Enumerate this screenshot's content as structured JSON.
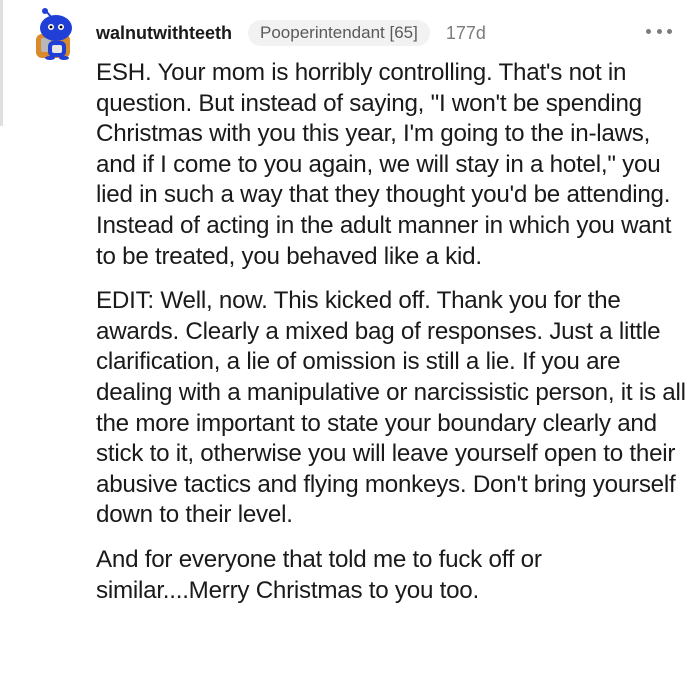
{
  "comment": {
    "username": "walnutwithteeth",
    "flair": "Pooperintendant [65]",
    "age": "177d",
    "more_icon": "more-options-icon",
    "avatar_icon": "snoo-avatar-icon",
    "paragraphs": [
      "ESH. Your mom is horribly controlling. That's not in question. But instead of saying, \"I won't be spending Christmas with you this year, I'm going to the in-laws, and if I come to you again, we will stay in a hotel,\" you lied in such a way that they thought you'd be attending. Instead of acting in the adult manner in which you want to be treated, you behaved like a kid.",
      "EDIT: Well, now. This kicked off. Thank you for the awards. Clearly a mixed bag of responses. Just a little clarification, a lie of omission is still a lie. If you are dealing with a manipulative or narcissistic person, it is all the more important to state your boundary clearly and stick to it, otherwise you will leave yourself open to their abusive tactics and flying monkeys. Don't bring yourself down to their level.",
      "And for everyone that told me to fuck off or similar....Merry Christmas to you too."
    ]
  },
  "colors": {
    "text": "#1a1a1b",
    "meta": "#7c7c7c",
    "flair_bg": "#f2f2f2",
    "avatar_blue": "#1f3fd6",
    "avatar_orange": "#d98a2b"
  }
}
